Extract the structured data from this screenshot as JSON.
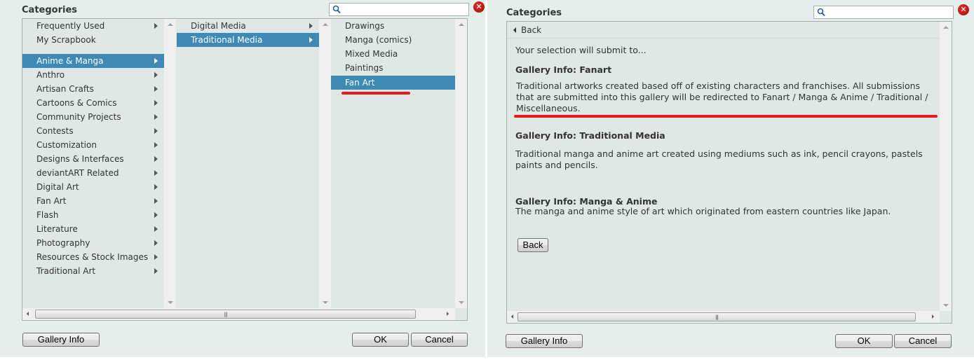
{
  "left_dialog": {
    "title": "Categories",
    "search": {
      "placeholder": "",
      "value": ""
    },
    "column1": [
      {
        "label": "Frequently Used",
        "has_children": true,
        "selected": false
      },
      {
        "label": "My Scrapbook",
        "has_children": false,
        "selected": false
      },
      {
        "label": "Anime & Manga",
        "has_children": true,
        "selected": true
      },
      {
        "label": "Anthro",
        "has_children": true,
        "selected": false
      },
      {
        "label": "Artisan Crafts",
        "has_children": true,
        "selected": false
      },
      {
        "label": "Cartoons & Comics",
        "has_children": true,
        "selected": false
      },
      {
        "label": "Community Projects",
        "has_children": true,
        "selected": false
      },
      {
        "label": "Contests",
        "has_children": true,
        "selected": false
      },
      {
        "label": "Customization",
        "has_children": true,
        "selected": false
      },
      {
        "label": "Designs & Interfaces",
        "has_children": true,
        "selected": false
      },
      {
        "label": "deviantART Related",
        "has_children": true,
        "selected": false
      },
      {
        "label": "Digital Art",
        "has_children": true,
        "selected": false
      },
      {
        "label": "Fan Art",
        "has_children": true,
        "selected": false
      },
      {
        "label": "Flash",
        "has_children": true,
        "selected": false
      },
      {
        "label": "Literature",
        "has_children": true,
        "selected": false
      },
      {
        "label": "Photography",
        "has_children": true,
        "selected": false
      },
      {
        "label": "Resources & Stock Images",
        "has_children": true,
        "selected": false
      },
      {
        "label": "Traditional Art",
        "has_children": true,
        "selected": false
      }
    ],
    "column2": [
      {
        "label": "Digital Media",
        "has_children": true,
        "selected": false
      },
      {
        "label": "Traditional Media",
        "has_children": true,
        "selected": true
      }
    ],
    "column3": [
      {
        "label": "Drawings",
        "has_children": false,
        "selected": false
      },
      {
        "label": "Manga (comics)",
        "has_children": false,
        "selected": false
      },
      {
        "label": "Mixed Media",
        "has_children": false,
        "selected": false
      },
      {
        "label": "Paintings",
        "has_children": false,
        "selected": false
      },
      {
        "label": "Fan Art",
        "has_children": false,
        "selected": true
      }
    ],
    "buttons": {
      "gallery_info": "Gallery Info",
      "ok": "OK",
      "cancel": "Cancel"
    }
  },
  "right_dialog": {
    "title": "Categories",
    "search": {
      "placeholder": "",
      "value": ""
    },
    "back_link": "Back",
    "intro": "Your selection will submit to...",
    "sections": [
      {
        "heading": "Gallery Info: Fanart",
        "body": "Traditional artworks created based off of existing characters and franchises. All submissions that are submitted into this gallery will be redirected to Fanart / Manga & Anime / Traditional / Miscellaneous."
      },
      {
        "heading": "Gallery Info: Traditional Media",
        "body": "Traditional manga and anime art created using mediums such as ink, pencil crayons, pastels paints and pencils."
      },
      {
        "heading": "Gallery Info: Manga & Anime",
        "body": "The manga and anime style of art which originated from eastern countries like Japan."
      }
    ],
    "back_button": "Back",
    "buttons": {
      "gallery_info": "Gallery Info",
      "ok": "OK",
      "cancel": "Cancel"
    }
  },
  "colors": {
    "selection": "#3f8ab5",
    "annotation": "#e8191f",
    "panel_bg": "#e5eeea",
    "list_bg": "#dfe8e4"
  }
}
